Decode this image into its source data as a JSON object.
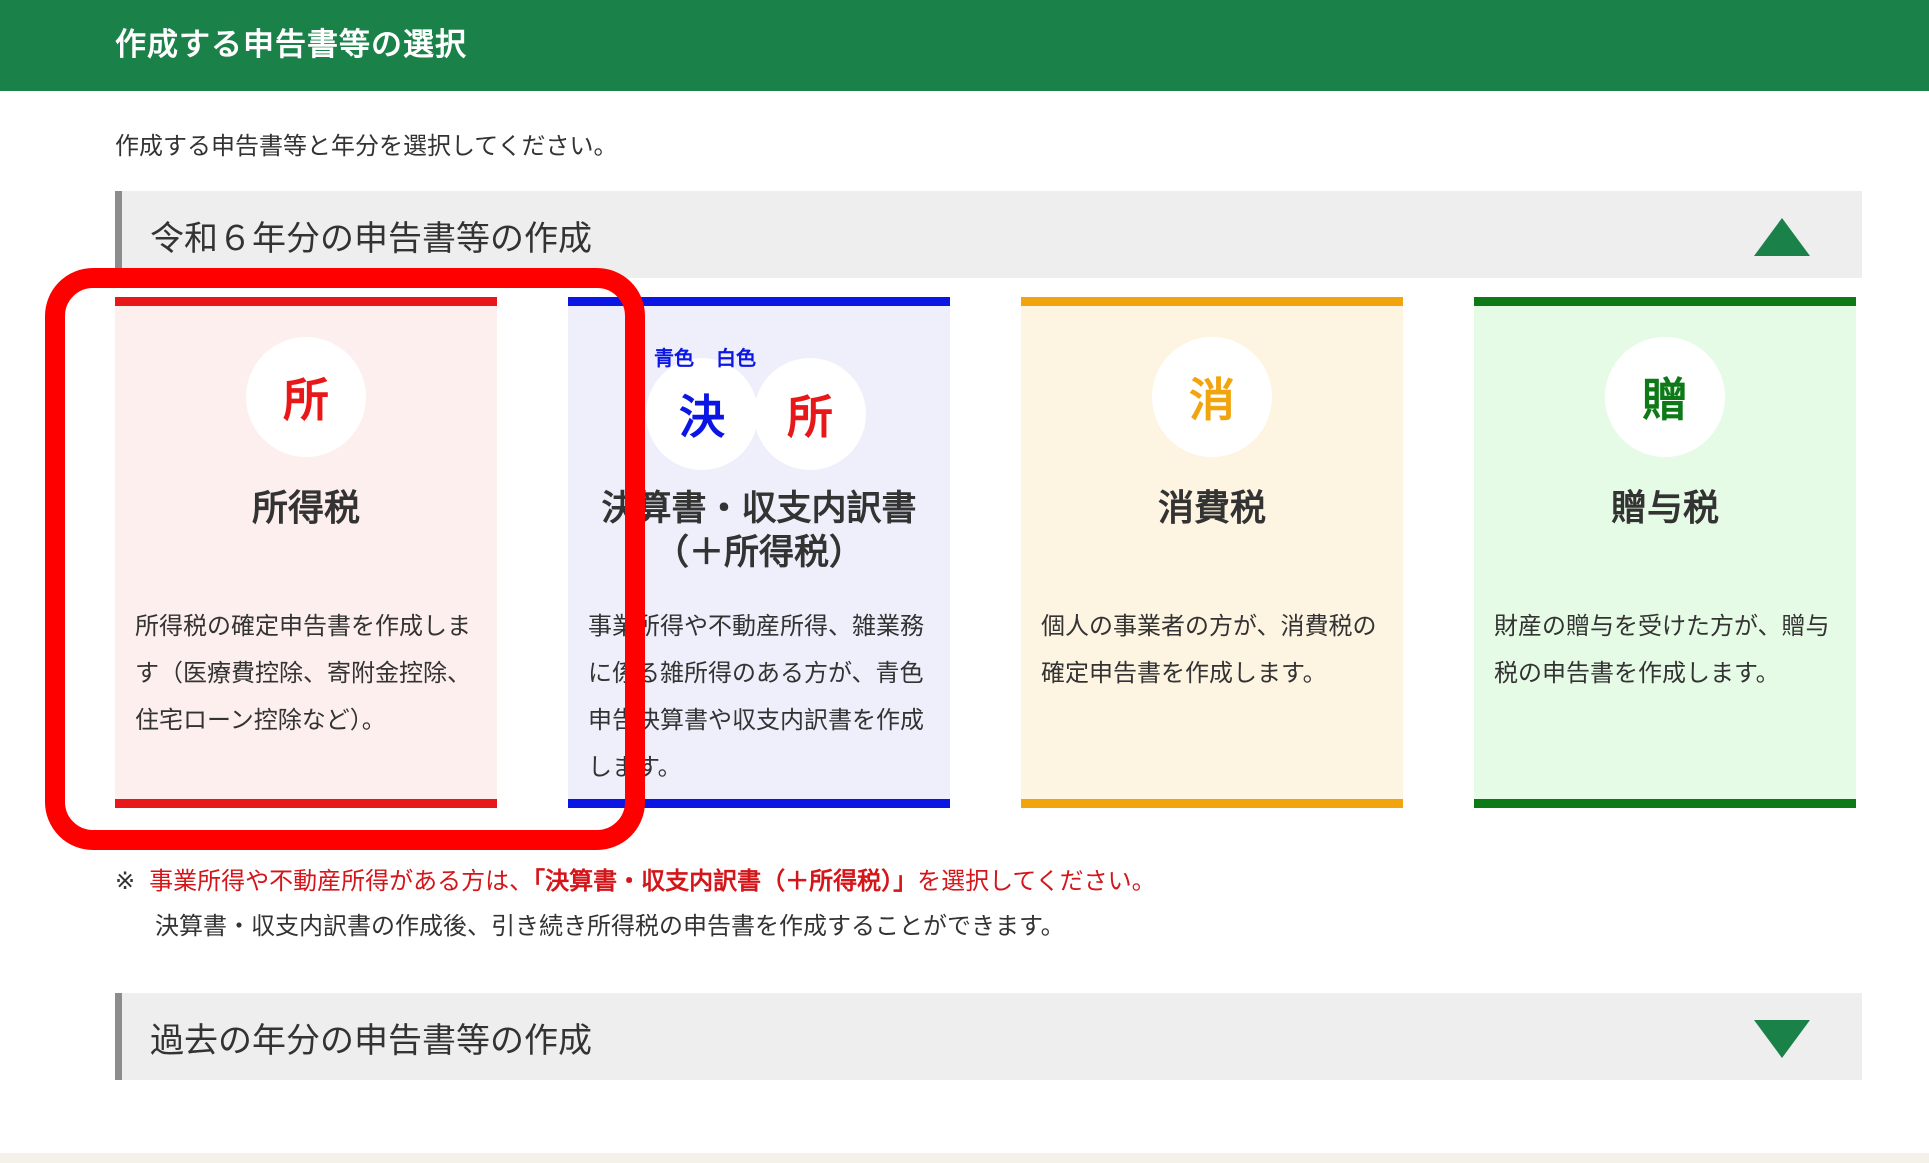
{
  "header": {
    "title": "作成する申告書等の選択"
  },
  "instruction": "作成する申告書等と年分を選択してください。",
  "current_section": {
    "title": "令和６年分の申告書等の作成",
    "toggle_icon": "triangle-up-icon"
  },
  "cards": [
    {
      "badge": "所",
      "title": "所得税",
      "desc": "所得税の確定申告書を作成します（医療費控除、寄附金控除、住宅ローン控除など）。",
      "color": "#e8181a"
    },
    {
      "badge_blue_label": "青色",
      "badge_white_label": "白色",
      "badge1": "決",
      "badge2": "所",
      "title_line1": "決算書・収支内訳書",
      "title_line2": "（＋所得税）",
      "desc": "事業所得や不動産所得、雑業務に係る雑所得のある方が、青色申告決算書や収支内訳書を作成します。",
      "color": "#0c16e4"
    },
    {
      "badge": "消",
      "title": "消費税",
      "desc": "個人の事業者の方が、消費税の確定申告書を作成します。",
      "color": "#f2a40e"
    },
    {
      "badge": "贈",
      "title": "贈与税",
      "desc": "財産の贈与を受けた方が、贈与税の申告書を作成します。",
      "color": "#0d7a17"
    }
  ],
  "note": {
    "mark": "※",
    "part1": "事業所得や不動産所得がある方は、",
    "part2": "「決算書・収支内訳書（＋所得税）」",
    "part3": "を選択してください。",
    "line2": "決算書・収支内訳書の作成後、引き続き所得税の申告書を作成することができます。"
  },
  "past_section": {
    "title": "過去の年分の申告書等の作成",
    "toggle_icon": "triangle-down-icon"
  },
  "colors": {
    "header_green": "#1a8249",
    "highlight_red": "#ff0000",
    "note_red": "#d4161b"
  }
}
